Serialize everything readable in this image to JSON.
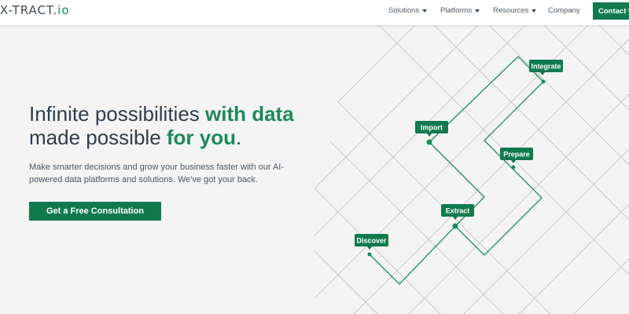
{
  "header": {
    "logo_main": "X-TRACT.",
    "logo_suffix": "io",
    "nav": [
      {
        "label": "Solutions"
      },
      {
        "label": "Platforms"
      },
      {
        "label": "Resources"
      },
      {
        "label": "Company"
      }
    ],
    "contact_label": "Contact Us"
  },
  "hero": {
    "headline_line1_plain": "Infinite possibilities ",
    "headline_line1_accent": "with data",
    "headline_line2_plain": "made possible ",
    "headline_line2_accent": "for you",
    "headline_period": ".",
    "subtext": "Make smarter decisions and grow your business faster with our AI-powered data platforms and solutions. We've got your back.",
    "cta_label": "Get a Free Consultation"
  },
  "network": {
    "tags": [
      "Integrate",
      "Import",
      "Prepare",
      "Extract",
      "Discover"
    ]
  },
  "colors": {
    "brand_green": "#117a4d",
    "accent_green": "#1d8a5a",
    "grid_line": "#c9c9c9"
  }
}
